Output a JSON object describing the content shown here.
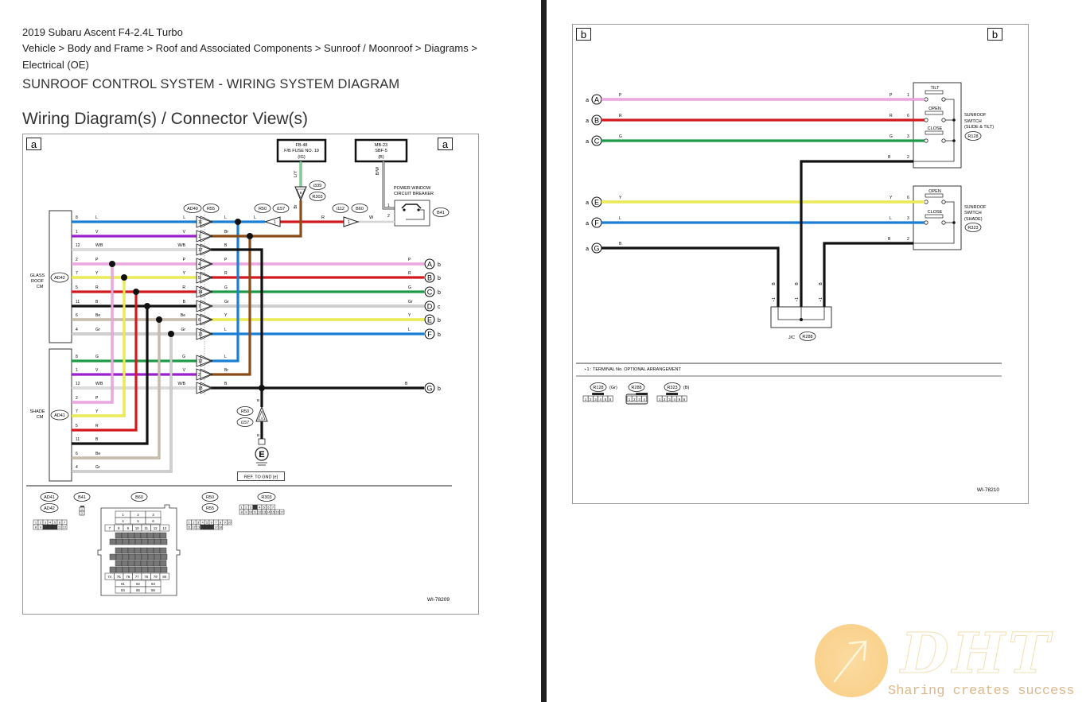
{
  "document": {
    "vehicle": "2019 Subaru Ascent F4-2.4L Turbo",
    "breadcrumb_line1": "Vehicle > Body and Frame > Roof and Associated Components > Sunroof / Moonroof > Diagrams >",
    "breadcrumb_line2": "Electrical (OE)",
    "title": "SUNROOF CONTROL SYSTEM - WIRING SYSTEM DIAGRAM",
    "section_heading": "Wiring Diagram(s) / Connector View(s)"
  },
  "diagram_a": {
    "page_tag": "a",
    "diagram_id": "WI-78209",
    "fuse_box_ig": {
      "line1": "FB-48",
      "line2": "F/B FUSE NO. 19",
      "line3": "(IG)"
    },
    "fuse_box_b": {
      "line1": "MB-23",
      "line2": "SBF-5",
      "line3": "(B)"
    },
    "breaker": {
      "line1": "POWER WINDOW",
      "line2": "CIRCUIT BREAKER",
      "connector": "B41",
      "pin1": "1",
      "pin2": "2"
    },
    "wire_ly": "L/Y",
    "wire_bw": "B/W",
    "wire_br_vertical": "Br",
    "connector_i339": "i339",
    "connector_r303": "R303",
    "connector_ad40": "AD40",
    "connector_r55": "R55",
    "connector_r50": "R50",
    "connector_i157": "i157",
    "connector_i112": "i112",
    "connector_b60": "B60",
    "wire_r_top": "R",
    "wire_w_top": "W",
    "pin_8_top": "8",
    "pin_1_a": "1",
    "pin_1_b": "1",
    "glass_roof_cm": {
      "line1": "GLASS",
      "line2": "ROOF",
      "line3": "CM",
      "connector": "AD42"
    },
    "shade_cm": {
      "line1": "SHADE",
      "line2": "CM",
      "connector": "AD41"
    },
    "glass_roof_rows": [
      {
        "pin": "8",
        "color_code": "L",
        "right_code": "L",
        "jpin": "11",
        "out_code": "L"
      },
      {
        "pin": "1",
        "color_code": "V",
        "right_code": "V",
        "jpin": "1",
        "out_code": "Br"
      },
      {
        "pin": "12",
        "color_code": "W/B",
        "right_code": "W/B",
        "jpin": "17",
        "out_code": "B"
      },
      {
        "pin": "2",
        "color_code": "P",
        "right_code": "P",
        "jpin": "4",
        "out_code": "P"
      },
      {
        "pin": "7",
        "color_code": "Y",
        "right_code": "Y",
        "jpin": "5",
        "out_code": "R"
      },
      {
        "pin": "5",
        "color_code": "R",
        "right_code": "R",
        "jpin": "14",
        "out_code": "G"
      },
      {
        "pin": "11",
        "color_code": "B",
        "right_code": "B",
        "jpin": "7",
        "out_code": "Gr"
      },
      {
        "pin": "6",
        "color_code": "Be",
        "right_code": "Be",
        "jpin": "6",
        "out_code": "Y"
      },
      {
        "pin": "4",
        "color_code": "Gr",
        "right_code": "Gr",
        "jpin": "15",
        "out_code": "L"
      }
    ],
    "shade_rows": [
      {
        "pin": "8",
        "color_code": "G",
        "right_code": "G",
        "jpin": "12",
        "out_code": "L"
      },
      {
        "pin": "1",
        "color_code": "V",
        "right_code": "V",
        "jpin": "2",
        "out_code": "Br"
      },
      {
        "pin": "12",
        "color_code": "W/B",
        "right_code": "W/B",
        "jpin": "18",
        "out_code": "B"
      },
      {
        "pin": "2",
        "color_code": "P"
      },
      {
        "pin": "7",
        "color_code": "Y"
      },
      {
        "pin": "5",
        "color_code": "R"
      },
      {
        "pin": "11",
        "color_code": "B"
      },
      {
        "pin": "6",
        "color_code": "Be"
      },
      {
        "pin": "4",
        "color_code": "Gr"
      }
    ],
    "outputs": [
      {
        "code": "P",
        "letter": "A",
        "page": "b"
      },
      {
        "code": "R",
        "letter": "B",
        "page": "b"
      },
      {
        "code": "G",
        "letter": "C",
        "page": "b"
      },
      {
        "code": "Gr",
        "letter": "D",
        "page": "c"
      },
      {
        "code": "Y",
        "letter": "E",
        "page": "b"
      },
      {
        "code": "L",
        "letter": "F",
        "page": "b"
      },
      {
        "code": "B",
        "letter": "G",
        "page": "b"
      }
    ],
    "ground": {
      "wire1": "B",
      "wire2": "B",
      "connector1": "R50",
      "connector2": "i157",
      "pin": "3",
      "symbol": "E",
      "ref": "REF. TO GND [e]"
    },
    "connector_views": [
      {
        "labels": [
          "AD41",
          "AD42"
        ],
        "rows": [
          [
            "1",
            "2",
            "3",
            "4",
            "5",
            "6",
            "7"
          ],
          [
            "8",
            "9",
            "",
            "",
            "",
            "11",
            "12"
          ]
        ]
      },
      {
        "labels": [
          "B41"
        ],
        "rows": [
          [
            "1"
          ],
          [
            "2"
          ]
        ]
      },
      {
        "labels": [
          "B60"
        ],
        "rows": [
          [
            "1",
            "2",
            "3"
          ],
          [
            "4",
            "5",
            "6"
          ],
          [
            "7",
            "8",
            "9",
            "10",
            "11",
            "12",
            "13"
          ],
          [
            "74",
            "75",
            "76",
            "77",
            "78",
            "79",
            "80"
          ],
          [
            "81",
            "82",
            "83"
          ],
          [
            "84",
            "85",
            "86"
          ]
        ]
      },
      {
        "labels": [
          "R50",
          "R55"
        ],
        "rows": [
          [
            "1",
            "2",
            "3",
            "4",
            "5",
            "6",
            "7",
            "8",
            "9",
            "10"
          ],
          [
            "11",
            "12",
            "13",
            "",
            "",
            "",
            "17",
            "18"
          ]
        ]
      },
      {
        "labels": [
          "R303"
        ],
        "rows": [
          [
            "1",
            "2",
            "3",
            "",
            "4",
            "5",
            "6",
            "7"
          ],
          [
            "8",
            "9",
            "10",
            "11",
            "12",
            "13",
            "14",
            "15",
            "16",
            "17"
          ]
        ]
      }
    ]
  },
  "diagram_b": {
    "page_tag_left": "b",
    "page_tag_right": "b",
    "diagram_id": "WI-78210",
    "inputs": [
      {
        "from": "a",
        "letter": "A",
        "code": "P",
        "right_code": "P",
        "pin": "1"
      },
      {
        "from": "a",
        "letter": "B",
        "code": "R",
        "right_code": "R",
        "pin": "6"
      },
      {
        "from": "a",
        "letter": "C",
        "code": "G",
        "right_code": "G",
        "pin": "3"
      },
      {
        "from": "a",
        "letter": "E",
        "code": "Y",
        "right_code": "Y",
        "pin": "6"
      },
      {
        "from": "a",
        "letter": "F",
        "code": "L",
        "right_code": "L",
        "pin": "3"
      },
      {
        "from": "a",
        "letter": "G",
        "code": "B"
      }
    ],
    "switch1": {
      "buttons": [
        "TILT",
        "OPEN",
        "CLOSE"
      ],
      "name_line1": "SUNROOF",
      "name_line2": "SWITCH",
      "name_line3": "(SLIDE & TILT)",
      "connector": "R128",
      "ground_code": "B",
      "ground_pin": "2"
    },
    "switch2": {
      "buttons": [
        "OPEN",
        "CLOSE"
      ],
      "name_line1": "SUNROOF",
      "name_line2": "SWITCH",
      "name_line3": "(SHADE)",
      "connector": "R323",
      "ground_code": "B",
      "ground_pin": "2"
    },
    "jc": {
      "label": "J/C",
      "connector": "R288",
      "wire_code": "B",
      "star": "⋆1"
    },
    "footnote": "⋆1  : TERMINAL No. OPTIONAL ARRANGEMENT",
    "connector_views": [
      {
        "label": "R128",
        "suffix": "(Gr)",
        "pins": [
          "1",
          "2",
          "3",
          "4",
          "5",
          "6"
        ]
      },
      {
        "label": "R288",
        "suffix": "",
        "pins": [
          "1",
          "2",
          "3",
          "4"
        ]
      },
      {
        "label": "R323",
        "suffix": "(B)",
        "pins": [
          "1",
          "2",
          "3",
          "4",
          "5",
          "6"
        ]
      }
    ]
  },
  "watermark": {
    "logo": "DHT",
    "tagline": "Sharing creates success"
  },
  "colors": {
    "L": "#1a7fd4",
    "V": "#9b1fcf",
    "WB": "#c8c8c8",
    "P": "#e38fd6",
    "Y": "#e2e22a",
    "R": "#d4191e",
    "G": "#1e9a46",
    "B": "#111111",
    "Be": "#b9aa98",
    "Gr": "#b0b0b0",
    "Br": "#8a4b16",
    "LY": "#3aa45a",
    "W": "#bdbdbd"
  }
}
